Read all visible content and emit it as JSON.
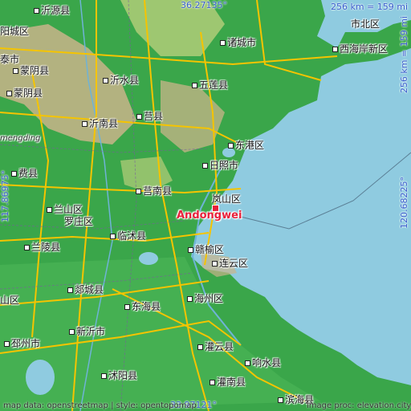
{
  "map": {
    "place_name": "Andongwei",
    "colors": {
      "sea": "#8fcbe0",
      "lowland": "#3aa64a",
      "hills": "#c9b48a",
      "roads": "#f5c400",
      "marker": "#e8203a",
      "coord_text": "#3a5fcd"
    },
    "coords": {
      "top": "36.27135°",
      "bottom": "33.97121°",
      "left": "117.86975°",
      "right": "120.68225°"
    },
    "scale": {
      "top": "256 km = 159 mi",
      "right": "256 km = 159 mi"
    },
    "footer": {
      "left": "map data: openstreetmap | style: opentopomap",
      "right": "image proc: elevation.city"
    },
    "labels": {
      "yiyuan": "沂源县",
      "chengyang": "阳城区",
      "shibei": "市北区",
      "zhucheng": "诸城市",
      "xihaian": "西海岸新区",
      "xintai": "泰市",
      "mengyin": "蒙阴县",
      "yishui": "沂水县",
      "wulian": "五莲县",
      "yinan": "沂南县",
      "ju": "莒县",
      "mengding": "mengding",
      "donggang": "东港区",
      "rizhao": "日照市",
      "fei": "费县",
      "junan": "莒南县",
      "lanshan_rz": "岚山区",
      "lanshan_ly": "兰山区",
      "luozhuang": "罗庄区",
      "linshu": "临沭县",
      "lanling": "兰陵县",
      "ganyu": "赣榆区",
      "lianyun": "连云区",
      "tancheng": "郯城县",
      "zone": "山区",
      "donghai": "东海县",
      "haizhou": "海州区",
      "pizhou": "邳州市",
      "xinyi": "新沂市",
      "guanyun": "灌云县",
      "xiangshui": "响水县",
      "shuyang": "沭阳县",
      "guannan": "灌南县",
      "binhai": "滨海县"
    }
  }
}
